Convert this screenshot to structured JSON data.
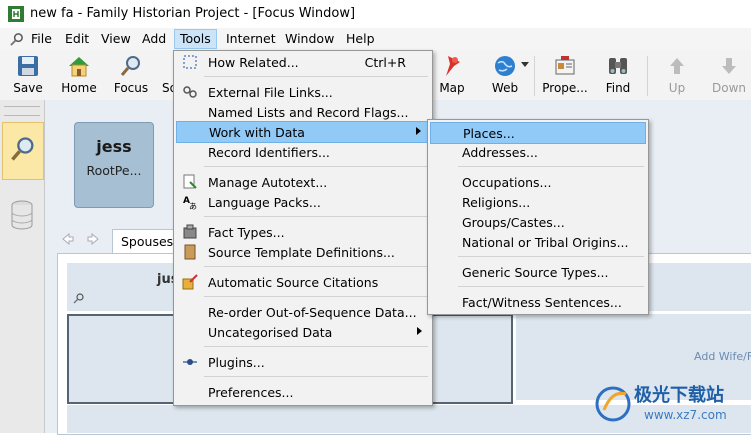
{
  "window": {
    "title": "new fa - Family Historian Project - [Focus Window]"
  },
  "menubar": {
    "items": [
      "File",
      "Edit",
      "View",
      "Add",
      "Tools",
      "Internet",
      "Window",
      "Help"
    ]
  },
  "toolbar": {
    "save": "Save",
    "home": "Home",
    "focus": "Focus",
    "so": "So",
    "map": "Map",
    "web": "Web",
    "properties": "Prope...",
    "find": "Find",
    "up": "Up",
    "down": "Down"
  },
  "focus": {
    "person_name": "jess",
    "person_role": "RootPe...",
    "tab_label": "Spouses",
    "child_partial": "jus",
    "add_wife": "Add Wife/F"
  },
  "tools_menu": [
    {
      "label": "How Related...",
      "shortcut": "Ctrl+R"
    },
    {
      "label": "External File Links..."
    },
    {
      "label": "Named Lists and Record Flags..."
    },
    {
      "label": "Work with Data"
    },
    {
      "label": "Record Identifiers..."
    },
    {
      "label": "Manage Autotext..."
    },
    {
      "label": "Language Packs..."
    },
    {
      "label": "Fact Types..."
    },
    {
      "label": "Source Template Definitions..."
    },
    {
      "label": "Automatic Source Citations"
    },
    {
      "label": "Re-order Out-of-Sequence Data..."
    },
    {
      "label": "Uncategorised Data"
    },
    {
      "label": "Plugins..."
    },
    {
      "label": "Preferences..."
    }
  ],
  "work_with_data_menu": [
    {
      "label": "Places..."
    },
    {
      "label": "Addresses..."
    },
    {
      "label": "Occupations..."
    },
    {
      "label": "Religions..."
    },
    {
      "label": "Groups/Castes..."
    },
    {
      "label": "National or Tribal Origins..."
    },
    {
      "label": "Generic Source Types..."
    },
    {
      "label": "Fact/Witness Sentences..."
    }
  ],
  "watermark": {
    "text": "极光下载站",
    "url": "www.xz7.com"
  },
  "colors": {
    "menu_highlight": "#91c9f7",
    "card": "#a6bfd3",
    "selected_panel": "#fbe7a6"
  }
}
